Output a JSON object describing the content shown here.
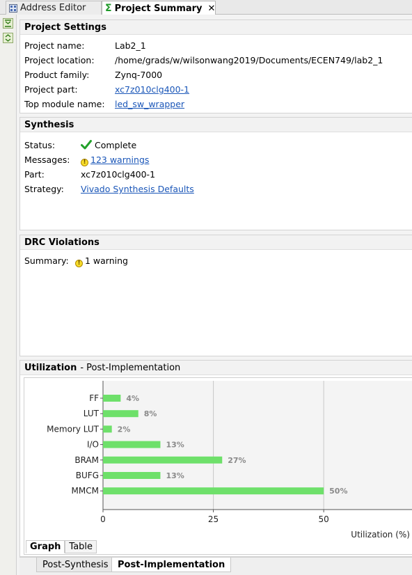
{
  "tabs": [
    {
      "label": "Address Editor",
      "icon": "address-editor-icon"
    },
    {
      "label": "Project Summary",
      "icon": "sigma-icon",
      "close": "✕"
    }
  ],
  "project_settings": {
    "title": "Project Settings",
    "rows": [
      {
        "label": "Project name:",
        "value": "Lab2_1"
      },
      {
        "label": "Project location:",
        "value": "/home/grads/w/wilsonwang2019/Documents/ECEN749/lab2_1"
      },
      {
        "label": "Product family:",
        "value": "Zynq-7000"
      },
      {
        "label": "Project part:",
        "value": "xc7z010clg400-1"
      },
      {
        "label": "Top module name:",
        "value": "led_sw_wrapper"
      }
    ]
  },
  "synthesis": {
    "title": "Synthesis",
    "status_label": "Status:",
    "status_value": "Complete",
    "messages_label": "Messages:",
    "messages_value": "123 warnings",
    "part_label": "Part:",
    "part_value": "xc7z010clg400-1",
    "strategy_label": "Strategy:",
    "strategy_value": "Vivado Synthesis Defaults"
  },
  "drc": {
    "title": "DRC Violations",
    "summary_label": "Summary:",
    "summary_value": "1 warning"
  },
  "utilization": {
    "title": "Utilization",
    "subtitle": "- Post-Implementation",
    "view_tabs": [
      "Graph",
      "Table"
    ],
    "bottom_tabs": [
      "Post-Synthesis",
      "Post-Implementation"
    ]
  },
  "chart_data": {
    "type": "bar",
    "orientation": "horizontal",
    "categories": [
      "FF",
      "LUT",
      "Memory LUT",
      "I/O",
      "BRAM",
      "BUFG",
      "MMCM"
    ],
    "values": [
      4,
      8,
      2,
      13,
      27,
      13,
      50
    ],
    "value_labels": [
      "4%",
      "8%",
      "2%",
      "13%",
      "27%",
      "13%",
      "50%"
    ],
    "xlabel": "Utilization (%)",
    "xticks": [
      "0",
      "25",
      "50"
    ],
    "xlim": [
      0,
      70
    ],
    "grid": true,
    "bar_color": "#6ee06a"
  }
}
